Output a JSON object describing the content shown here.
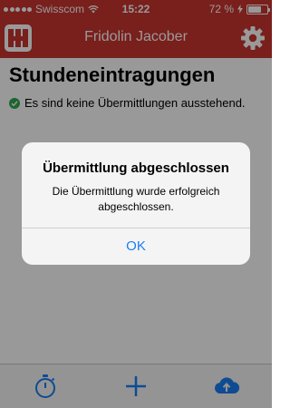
{
  "status_bar": {
    "carrier": "Swisscom",
    "time": "15:22",
    "battery_text": "72 %",
    "battery_level": 0.72,
    "signal_icon": "signal-dots-icon",
    "wifi_icon": "wifi-icon",
    "charging_icon": "bolt-icon"
  },
  "header": {
    "title": "Fridolin Jacober",
    "logo_icon": "app-logo-icon",
    "settings_icon": "gear-icon"
  },
  "main": {
    "title": "Stundeneintragungen",
    "status_text": "Es sind keine Übermittlungen ausstehend.",
    "status_icon": "check-circle-icon"
  },
  "tab_bar": {
    "items": [
      {
        "icon": "stopwatch-icon"
      },
      {
        "icon": "plus-icon"
      },
      {
        "icon": "cloud-upload-icon"
      }
    ]
  },
  "alert": {
    "title": "Übermittlung abgeschlossen",
    "message": "Die Übermittlung wurde erfolgreich abgeschlossen.",
    "ok_label": "OK"
  },
  "colors": {
    "brand": "#ca3530",
    "accent": "#1a7ef5",
    "success": "#2fa84f"
  }
}
